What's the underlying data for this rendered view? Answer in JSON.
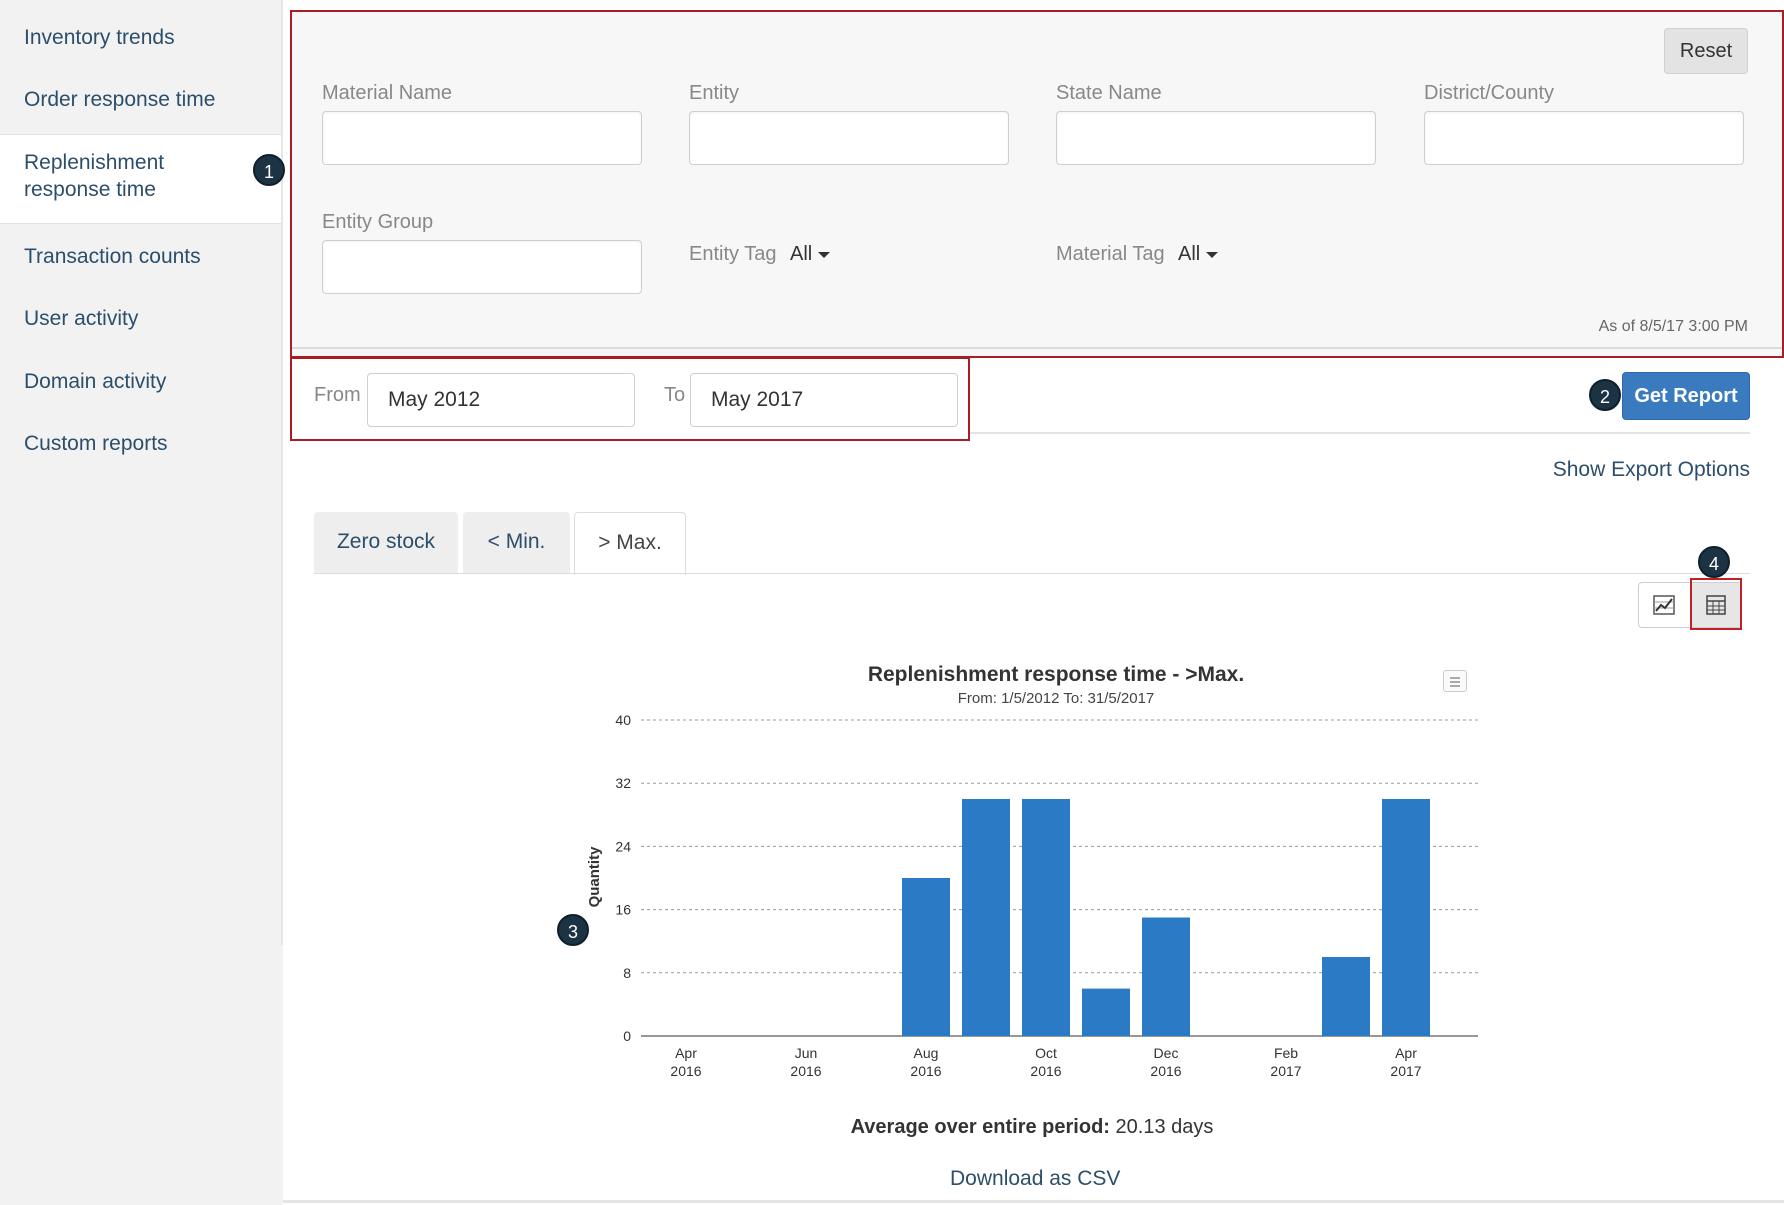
{
  "sidebar": {
    "items": [
      {
        "label": "Inventory trends"
      },
      {
        "label": "Order response time"
      },
      {
        "label": "Replenishment response time"
      },
      {
        "label": "Transaction counts"
      },
      {
        "label": "User activity"
      },
      {
        "label": "Domain activity"
      },
      {
        "label": "Custom reports"
      }
    ]
  },
  "badges": [
    "1",
    "2",
    "3",
    "4"
  ],
  "filters": {
    "reset_label": "Reset",
    "material_name_label": "Material Name",
    "entity_label": "Entity",
    "state_name_label": "State Name",
    "district_label": "District/County",
    "entity_group_label": "Entity Group",
    "entity_tag_label": "Entity Tag",
    "entity_tag_value": "All",
    "material_tag_label": "Material Tag",
    "material_tag_value": "All",
    "as_of": "As of 8/5/17 3:00 PM"
  },
  "date_range": {
    "from_label": "From",
    "from_value": "May 2012",
    "to_label": "To",
    "to_value": "May 2017"
  },
  "get_report_label": "Get Report",
  "export_label": "Show Export Options",
  "tabs": [
    {
      "label": "Zero stock"
    },
    {
      "label": "< Min."
    },
    {
      "label": "> Max."
    }
  ],
  "active_tab": "> Max.",
  "chart_data": {
    "type": "bar",
    "title": "Replenishment response time - >Max.",
    "subtitle": "From: 1/5/2012 To: 31/5/2017",
    "ylabel": "Quantity",
    "xlabel": "",
    "ylim": [
      0,
      40
    ],
    "yticks": [
      0,
      8,
      16,
      24,
      32,
      40
    ],
    "categories": [
      "Apr 2016",
      "May 2016",
      "Jun 2016",
      "Jul 2016",
      "Aug 2016",
      "Sep 2016",
      "Oct 2016",
      "Nov 2016",
      "Dec 2016",
      "Jan 2017",
      "Feb 2017",
      "Mar 2017",
      "Apr 2017"
    ],
    "values": [
      0,
      0,
      0,
      0,
      20,
      30,
      30,
      6,
      15,
      0,
      0,
      10,
      30
    ],
    "xtick_labels": [
      {
        "index": 0,
        "line1": "Apr",
        "line2": "2016"
      },
      {
        "index": 2,
        "line1": "Jun",
        "line2": "2016"
      },
      {
        "index": 4,
        "line1": "Aug",
        "line2": "2016"
      },
      {
        "index": 6,
        "line1": "Oct",
        "line2": "2016"
      },
      {
        "index": 8,
        "line1": "Dec",
        "line2": "2016"
      },
      {
        "index": 10,
        "line1": "Feb",
        "line2": "2017"
      },
      {
        "index": 12,
        "line1": "Apr",
        "line2": "2017"
      }
    ],
    "bar_color": "#2b7ac6",
    "grid": true,
    "legend": "none"
  },
  "average": {
    "label": "Average over entire period:",
    "value": "20.13 days"
  },
  "download_label": "Download as CSV"
}
